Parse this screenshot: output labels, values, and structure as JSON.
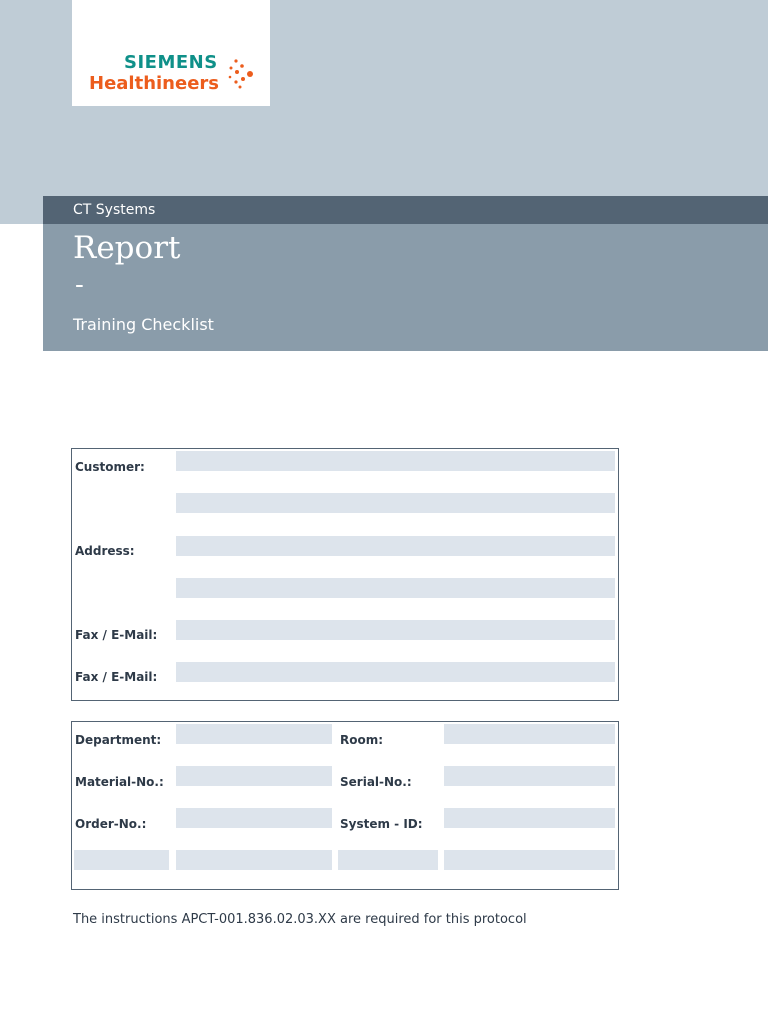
{
  "logo": {
    "line1": "SIEMENS",
    "line2": "Healthineers"
  },
  "header": {
    "category": "CT Systems",
    "title": "Report",
    "separator": "-",
    "subtitle": "Training Checklist"
  },
  "customer_box": {
    "customer": "Customer:",
    "address": "Address:",
    "fax1": "Fax / E-Mail:",
    "fax2": "Fax / E-Mail:"
  },
  "system_box": {
    "department": "Department:",
    "room": "Room:",
    "material": "Material-No.:",
    "serial": "Serial-No.:",
    "order": "Order-No.:",
    "system_id": "System - ID:"
  },
  "footer": "The instructions APCT-001.836.02.03.XX are required for this protocol",
  "colors": {
    "teal": "#0f9089",
    "orange": "#ec5d1d",
    "field": "#dde4ec"
  }
}
